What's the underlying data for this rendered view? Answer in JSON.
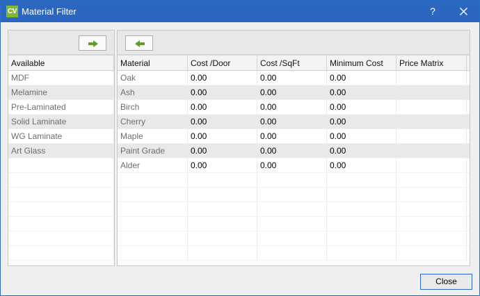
{
  "window": {
    "title": "Material Filter",
    "app_badge": "CV",
    "help_glyph": "?"
  },
  "colors": {
    "titlebar": "#2b67c1",
    "app_badge": "#7fb832",
    "arrow": "#5e9b2f"
  },
  "left": {
    "move_button_icon": "arrow-right-icon",
    "header": "Available",
    "items": [
      "MDF",
      "Melamine",
      "Pre-Laminated",
      "Solid Laminate",
      "WG Laminate",
      "Art Glass"
    ]
  },
  "right": {
    "move_button_icon": "arrow-left-icon",
    "headers": [
      "Material",
      "Cost /Door",
      "Cost /SqFt",
      "Minimum Cost",
      "Price Matrix"
    ],
    "rows": [
      [
        "Oak",
        "0.00",
        "0.00",
        "0.00",
        ""
      ],
      [
        "Ash",
        "0.00",
        "0.00",
        "0.00",
        ""
      ],
      [
        "Birch",
        "0.00",
        "0.00",
        "0.00",
        ""
      ],
      [
        "Cherry",
        "0.00",
        "0.00",
        "0.00",
        ""
      ],
      [
        "Maple",
        "0.00",
        "0.00",
        "0.00",
        ""
      ],
      [
        "Paint Grade",
        "0.00",
        "0.00",
        "0.00",
        ""
      ],
      [
        "Alder",
        "0.00",
        "0.00",
        "0.00",
        ""
      ]
    ]
  },
  "footer": {
    "close_label": "Close"
  }
}
